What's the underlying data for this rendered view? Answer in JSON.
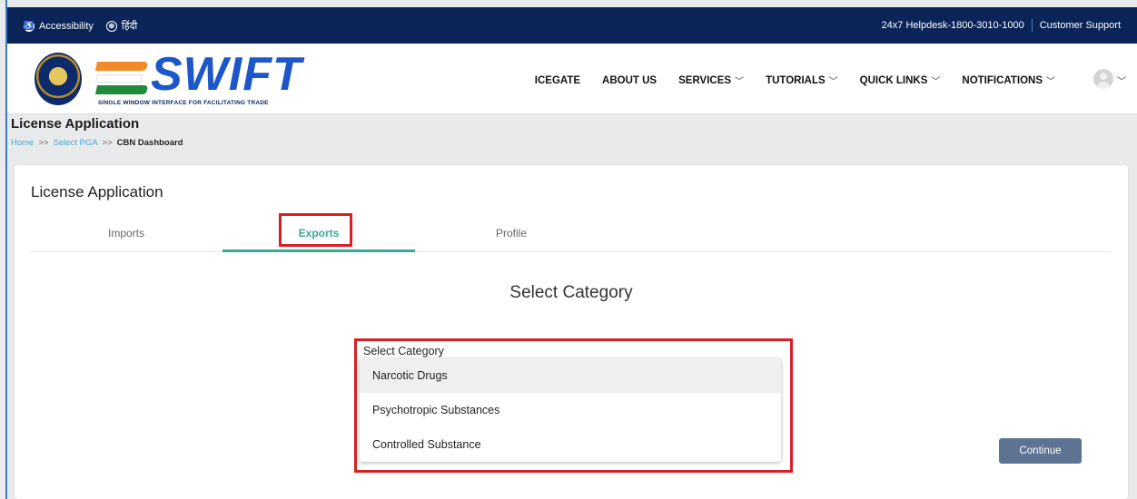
{
  "topbar": {
    "accessibility": "Accessibility",
    "language": "हिंदी",
    "helpdesk": "24x7 Helpdesk-1800-3010-1000",
    "support": "Customer Support"
  },
  "logo": {
    "name": "SWIFT",
    "tagline": "SINGLE WINDOW INTERFACE FOR FACILITATING TRADE"
  },
  "nav": {
    "items": [
      "ICEGATE",
      "ABOUT US",
      "SERVICES",
      "TUTORIALS",
      "QUICK LINKS",
      "NOTIFICATIONS"
    ],
    "chevron": "﹀"
  },
  "page": {
    "title": "License Application",
    "breadcrumb": {
      "home": "Home",
      "sep": ">>",
      "mid": "Select PGA",
      "current": "CBN Dashboard"
    }
  },
  "card": {
    "title": "License Application",
    "tabs": [
      "Imports",
      "Exports",
      "Profile"
    ],
    "active_tab": "Exports",
    "section_title": "Select Category",
    "select_label": "Select Category",
    "options": [
      "Narcotic Drugs",
      "Psychotropic Substances",
      "Controlled Substance"
    ],
    "continue_label": "Continue"
  },
  "colors": {
    "topbar": "#0b2458",
    "brand": "#1c56c9",
    "active_tab": "#3aa993",
    "highlight_box": "#d81f26",
    "button": "#5d7393"
  }
}
